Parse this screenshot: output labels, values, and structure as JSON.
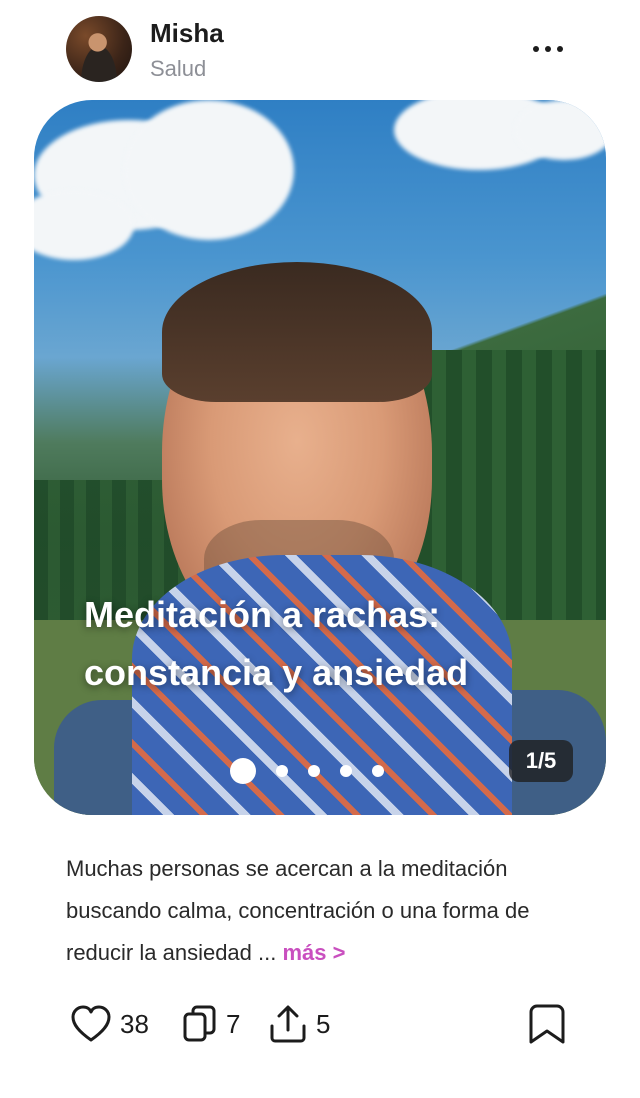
{
  "post": {
    "author": "Misha",
    "category": "Salud",
    "title": "Meditación a rachas: constancia y ansiedad",
    "slide_counter": "1/5",
    "slides_total": 5,
    "slide_active": 1,
    "description": "Muchas personas se acercan a la meditación buscando calma, concentración o una forma de reducir la ansiedad ...",
    "more_label": "más >"
  },
  "actions": {
    "likes": "38",
    "reposts": "7",
    "shares": "5"
  },
  "icons": {
    "more": "more-horizontal-icon",
    "like": "heart-icon",
    "repost": "copy-stack-icon",
    "share": "share-upload-icon",
    "save": "bookmark-icon"
  },
  "colors": {
    "accent": "#c94fbf",
    "text": "#1c1c1c",
    "muted": "#8d8f96"
  }
}
